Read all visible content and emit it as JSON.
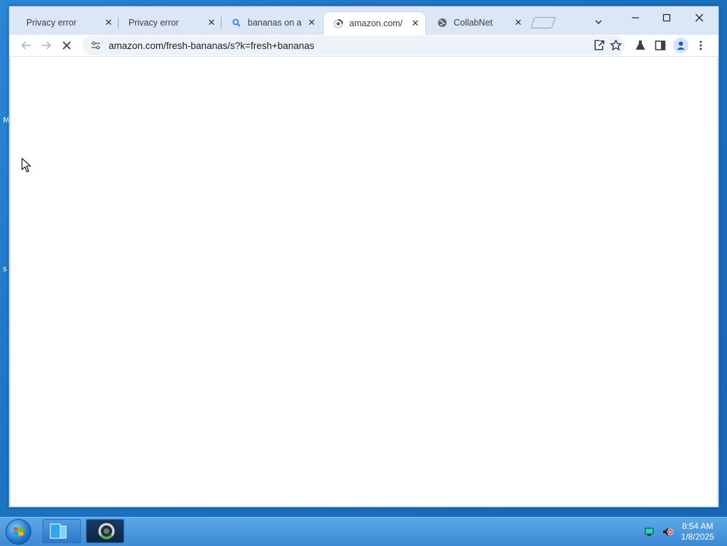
{
  "browser": {
    "tabs": [
      {
        "label": "Privacy error",
        "icon": "warning-page-icon",
        "active": false
      },
      {
        "label": "Privacy error",
        "icon": "warning-page-icon",
        "active": false
      },
      {
        "label": "bananas on a",
        "icon": "search-icon",
        "active": false
      },
      {
        "label": "amazon.com/",
        "icon": "loading-spinner-icon",
        "active": true
      },
      {
        "label": "CollabNet",
        "icon": "globe-icon",
        "active": false
      }
    ],
    "url": "amazon.com/fresh-bananas/s?k=fresh+bananas"
  },
  "taskbar": {
    "time": "8:54 AM",
    "date": "1/8/2025"
  },
  "colors": {
    "desktop": "#1c73c1",
    "window_frame": "#dbe6f6",
    "taskbar": "#3d8ad6"
  }
}
